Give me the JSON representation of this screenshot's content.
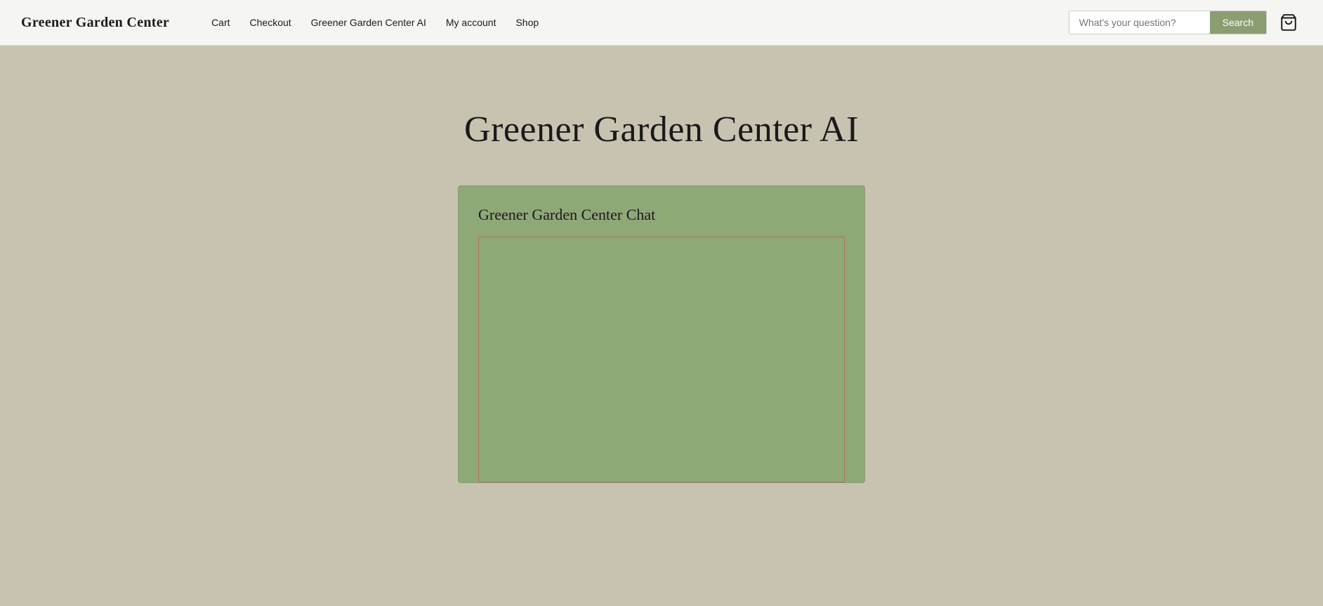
{
  "site": {
    "title": "Greener Garden Center"
  },
  "nav": {
    "links": [
      {
        "id": "cart",
        "label": "Cart"
      },
      {
        "id": "checkout",
        "label": "Checkout"
      },
      {
        "id": "ai",
        "label": "Greener Garden Center AI"
      },
      {
        "id": "my-account",
        "label": "My account"
      },
      {
        "id": "shop",
        "label": "Shop"
      }
    ]
  },
  "search": {
    "placeholder": "What's your question?",
    "button_label": "Search"
  },
  "main": {
    "page_title": "Greener Garden Center AI",
    "chat_card": {
      "title": "Greener Garden Center Chat"
    }
  },
  "colors": {
    "background": "#c8c3b0",
    "header_bg": "#f5f5f2",
    "search_btn": "#8a9e72",
    "chat_card_bg": "#8fa878",
    "chat_area_border": "#b87060"
  }
}
